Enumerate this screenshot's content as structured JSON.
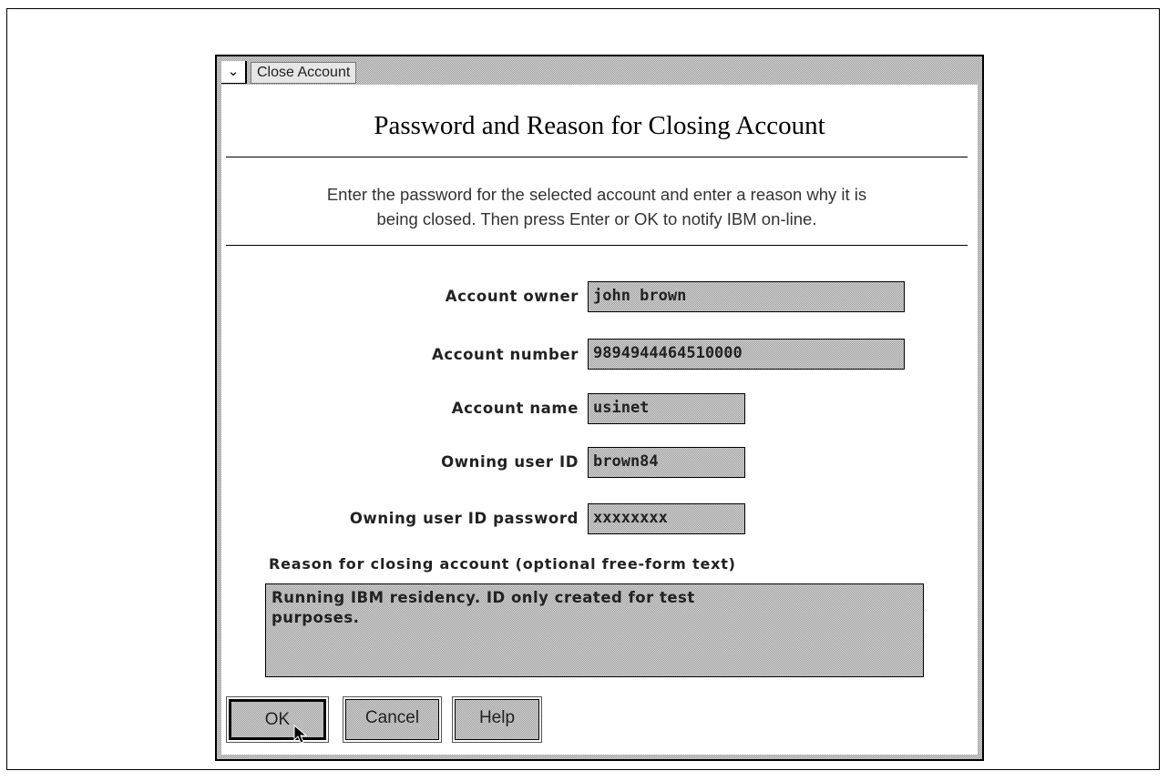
{
  "window": {
    "title": "Close Account",
    "system_menu_glyph": "⌄"
  },
  "heading": "Password and Reason for Closing Account",
  "instructions": {
    "line1": "Enter the password for the selected account and enter a reason why it is",
    "line2": "being closed. Then press Enter or OK to notify IBM on-line."
  },
  "fields": {
    "account_owner": {
      "label": "Account owner",
      "value": "john brown"
    },
    "account_number": {
      "label": "Account number",
      "value": "9894944464510000"
    },
    "account_name": {
      "label": "Account name",
      "value": "usinet"
    },
    "owning_user_id": {
      "label": "Owning user ID",
      "value": "brown84"
    },
    "owning_user_id_password": {
      "label": "Owning user ID password",
      "value": "xxxxxxxx"
    }
  },
  "reason": {
    "label": "Reason for closing account (optional free-form text)",
    "line1": "Running IBM residency. ID only created for test",
    "line2": "purposes."
  },
  "buttons": {
    "ok": "OK",
    "cancel": "Cancel",
    "help": "Help"
  },
  "icons": {
    "system_menu": "system-menu-icon",
    "cursor": "mouse-pointer-icon"
  }
}
